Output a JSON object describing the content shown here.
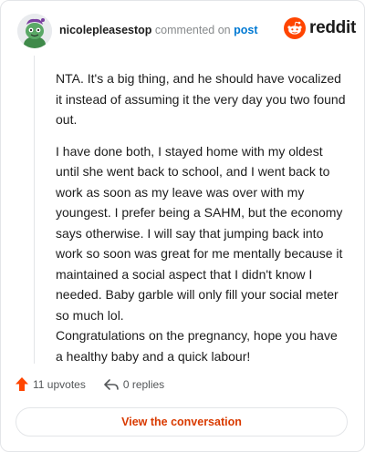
{
  "header": {
    "username": "nicolepleasestop",
    "commented": "commented on",
    "post_link": "post"
  },
  "brand": {
    "name": "reddit",
    "color": "#ff4500"
  },
  "avatar": {
    "icon": "snoo-avatar-icon"
  },
  "comment": {
    "paragraphs": [
      "NTA. It's a big thing, and he should have vocalized it instead of assuming it the very day you two found out.",
      "I have done both, I stayed home with my oldest until she went back to school, and I went back to work as soon as my leave was over with my youngest. I prefer being a SAHM, but the economy says otherwise. I will say that jumping back into work so soon was great for me mentally because it maintained a social aspect that I didn't know I needed. Baby garble will only fill your social meter so much lol.",
      "Congratulations on the pregnancy, hope you have a healthy baby and a quick labour!"
    ]
  },
  "actions": {
    "upvotes": "11 upvotes",
    "replies": "0 replies"
  },
  "cta": {
    "label": "View the conversation",
    "color": "#d93a00"
  }
}
